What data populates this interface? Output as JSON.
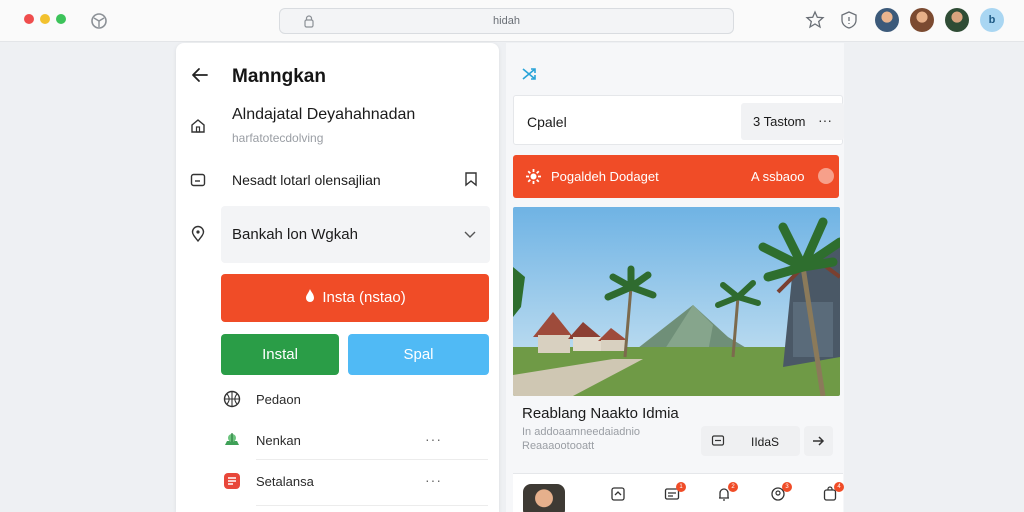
{
  "browser": {
    "url": "hidah"
  },
  "left_panel": {
    "title": "Manngkan",
    "row1": {
      "title": "Alndajatal Deyahahnadan",
      "subtitle": "harfatotecdolving"
    },
    "row2": {
      "label": "Nesadt lotarl olensajlian"
    },
    "select": {
      "value": "Bankah lon Wgkah"
    },
    "primary_button": "Insta (nstao)",
    "green_button": "Instal",
    "blue_button": "Spal",
    "list": [
      {
        "label": "Pedaon",
        "icon": "basketball-icon",
        "dots": ""
      },
      {
        "label": "Nenkan",
        "icon": "green-leaf-icon",
        "dots": "···"
      },
      {
        "label": "Setalansa",
        "icon": "red-app-icon",
        "dots": "···"
      }
    ]
  },
  "right_panel": {
    "card": {
      "title": "Cpalel",
      "tag": "3 Tastom",
      "dots": "···"
    },
    "banner": {
      "text": "Pogaldeh Dodaget",
      "right_text": "A ssbaoo"
    },
    "photo": {
      "title": "Reablang Naakto Idmia",
      "subtitle1": "In addoaamneedaiadnio",
      "subtitle2": "Reaaaootooatt",
      "count_label": "IIdaS"
    }
  },
  "colors": {
    "accent_orange": "#f04c27",
    "accent_green": "#2a9d47",
    "accent_blue": "#50baf5"
  }
}
